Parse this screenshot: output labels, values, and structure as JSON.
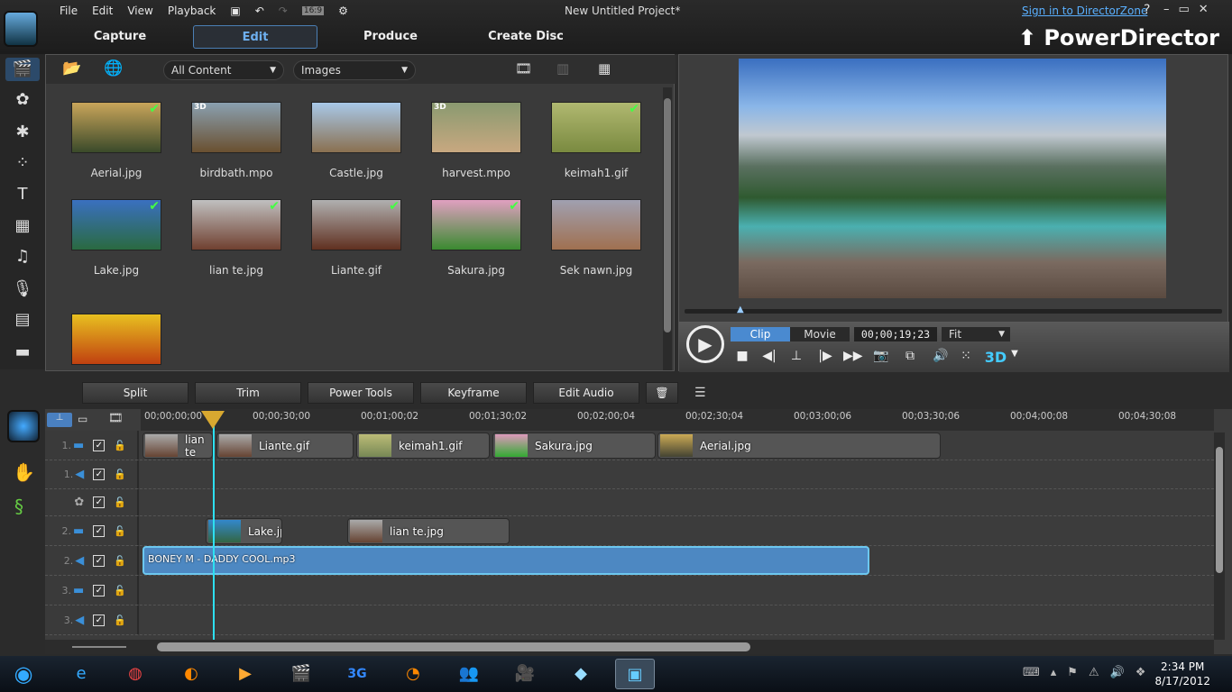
{
  "window": {
    "title": "New Untitled Project*",
    "sign_in": "Sign in to DirectorZone",
    "help": "?",
    "brand": "PowerDirector"
  },
  "menu": [
    "File",
    "Edit",
    "View",
    "Playback"
  ],
  "aspect": "16:9",
  "tabs": [
    {
      "label": "Capture"
    },
    {
      "label": "Edit",
      "active": true
    },
    {
      "label": "Produce"
    },
    {
      "label": "Create Disc"
    }
  ],
  "library": {
    "filter": "All Content",
    "type": "Images",
    "items": [
      {
        "name": "Aerial.jpg",
        "checked": true,
        "is3d": false,
        "colors": [
          "#c9a55a",
          "#3a4a2a"
        ]
      },
      {
        "name": "birdbath.mpo",
        "checked": false,
        "is3d": true,
        "colors": [
          "#8aa0b0",
          "#6a5030"
        ]
      },
      {
        "name": "Castle.jpg",
        "checked": false,
        "is3d": false,
        "colors": [
          "#a8c8e8",
          "#8a7050"
        ]
      },
      {
        "name": "harvest.mpo",
        "checked": false,
        "is3d": true,
        "colors": [
          "#8a9a70",
          "#c8a880"
        ]
      },
      {
        "name": "keimah1.gif",
        "checked": true,
        "is3d": false,
        "colors": [
          "#b0b870",
          "#7a8a40"
        ]
      },
      {
        "name": "Lake.jpg",
        "checked": true,
        "is3d": false,
        "colors": [
          "#3a70c0",
          "#2a6a40"
        ]
      },
      {
        "name": "lian te.jpg",
        "checked": true,
        "is3d": false,
        "colors": [
          "#c0c0c0",
          "#704030"
        ]
      },
      {
        "name": "Liante.gif",
        "checked": true,
        "is3d": false,
        "colors": [
          "#b0b0b0",
          "#603020"
        ]
      },
      {
        "name": "Sakura.jpg",
        "checked": true,
        "is3d": false,
        "colors": [
          "#e0a0c0",
          "#3a8a30"
        ]
      },
      {
        "name": "Sek nawn.jpg",
        "checked": false,
        "is3d": false,
        "colors": [
          "#a0a0b0",
          "#a07050"
        ]
      },
      {
        "name": "",
        "checked": false,
        "is3d": false,
        "colors": [
          "#e8c020",
          "#c04010"
        ]
      }
    ]
  },
  "preview": {
    "modes": [
      "Clip",
      "Movie"
    ],
    "active_mode": "Clip",
    "timecode": "00;00;19;23",
    "zoom": "Fit",
    "stereo": "3D"
  },
  "edit_toolbar": [
    "Split",
    "Trim",
    "Power Tools",
    "Keyframe",
    "Edit Audio"
  ],
  "timeline": {
    "ruler": [
      "00;00;00;00",
      "00;00;30;00",
      "00;01;00;02",
      "00;01;30;02",
      "00;02;00;04",
      "00;02;30;04",
      "00;03;00;06",
      "00;03;30;06",
      "00;04;00;08",
      "00;04;30;08"
    ],
    "tracks": [
      {
        "label": "1.",
        "kind": "video"
      },
      {
        "label": "1.",
        "kind": "audio"
      },
      {
        "label": "",
        "kind": "fx"
      },
      {
        "label": "2.",
        "kind": "video"
      },
      {
        "label": "2.",
        "kind": "audio"
      },
      {
        "label": "3.",
        "kind": "video"
      },
      {
        "label": "3.",
        "kind": "audio"
      }
    ],
    "track1_clips": [
      "lian te",
      "Liante.gif",
      "keimah1.gif",
      "Sakura.jpg",
      "Aerial.jpg"
    ],
    "track2_clips": [
      "Lake.jpg",
      "lian te.jpg"
    ],
    "audio_clip": "BONEY M - DADDY COOL.mp3"
  },
  "taskbar": {
    "time": "2:34 PM",
    "date": "8/17/2012"
  }
}
